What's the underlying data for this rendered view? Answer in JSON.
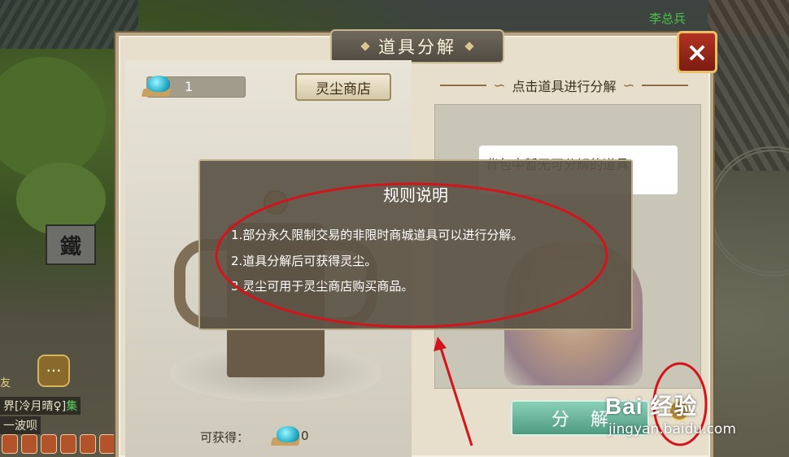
{
  "scene": {
    "npc_name": "李总兵",
    "sign_text": "鐵",
    "side_friend_label": "友",
    "chat": {
      "line1_prefix": "界",
      "line1_name": "[冷月晴♀]",
      "line1_extra": "集",
      "line2": "一波呗"
    }
  },
  "panel": {
    "title": "道具分解",
    "close_icon": "×",
    "currency_value": "1",
    "shop_button": "灵尘商店",
    "right_header": "点击道具进行分解",
    "empty_tip": "背包中暂无可分解的道具",
    "obtain_label": "可获得：",
    "obtain_value": "0",
    "decompose_button": "分解"
  },
  "rules": {
    "title": "规则说明",
    "lines": [
      "1.部分永久限制交易的非限时商城道具可以进行分解。",
      "2.道具分解后可获得灵尘。",
      "3.灵尘可用于灵尘商店购买商品。"
    ]
  },
  "watermark": {
    "main": "Bai 经验",
    "sub": "jingyan.baidu.com"
  },
  "colors": {
    "annotation_red": "#d3141b",
    "decompose_green": "#5ea98d",
    "close_red": "#a02a1c"
  }
}
